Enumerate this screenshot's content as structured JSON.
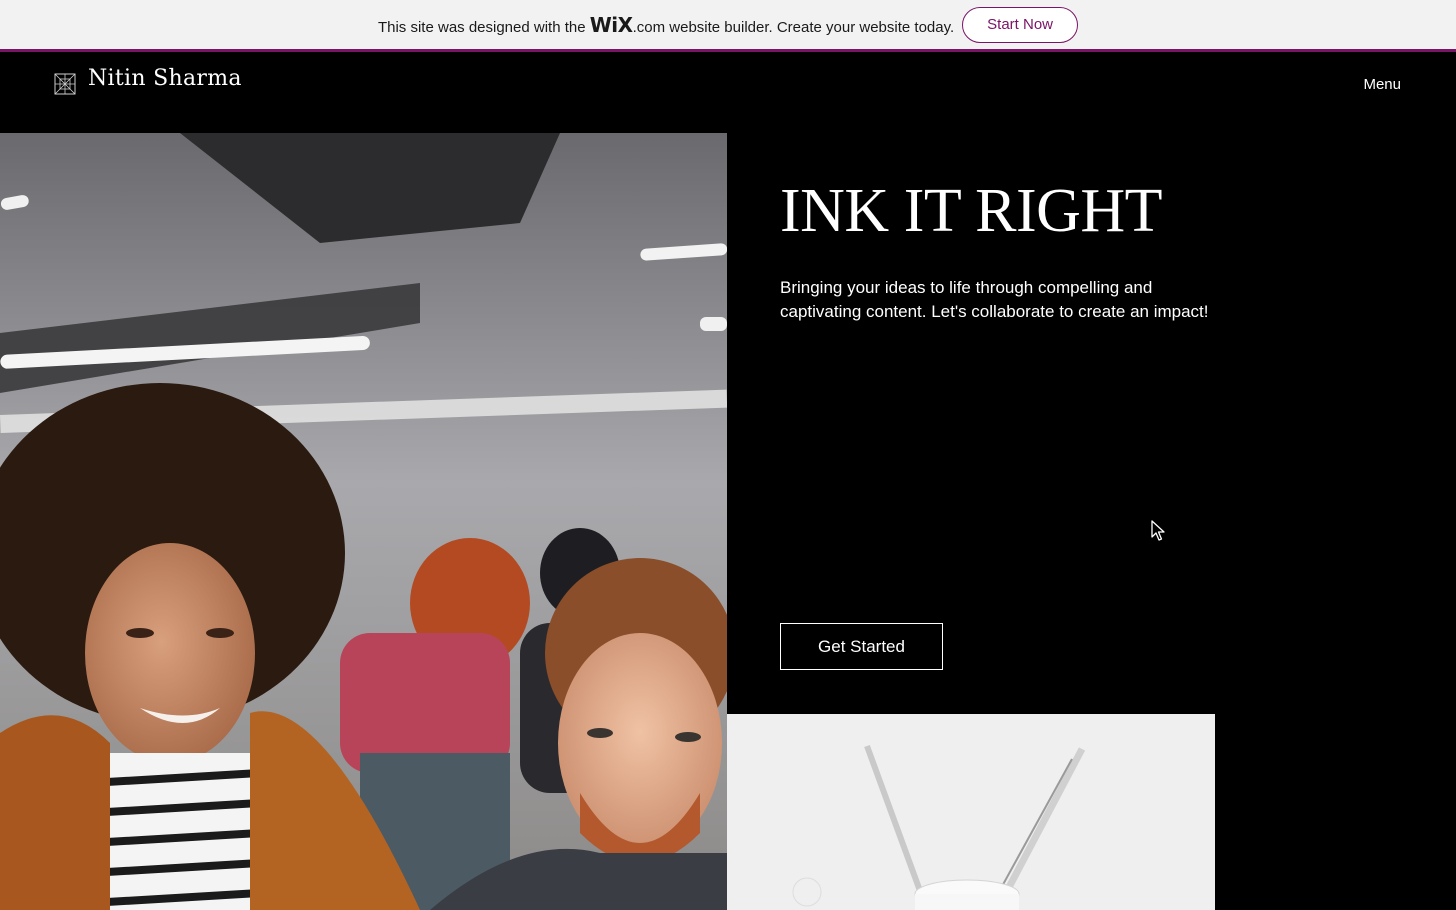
{
  "wix_banner": {
    "text_before": "This site was designed with the ",
    "logo_main": "WiX",
    "logo_suffix": ".com",
    "text_after": " website builder. Create your website today.",
    "button_label": "Start Now",
    "accent_color": "#7a1466"
  },
  "header": {
    "logo_icon": "geometric-mark-icon",
    "title": "Nitin Sharma",
    "menu_label": "Menu"
  },
  "hero": {
    "heading": "INK IT RIGHT",
    "subtitle": "Bringing your ideas to life through compelling and captivating content. Let's collaborate to create an impact!",
    "button_label": "Get Started",
    "photo": "smiling-coworkers-office-photo"
  },
  "secondary_photo": "pens-in-white-cup-photo",
  "cursor_icon": "mouse-pointer-icon"
}
